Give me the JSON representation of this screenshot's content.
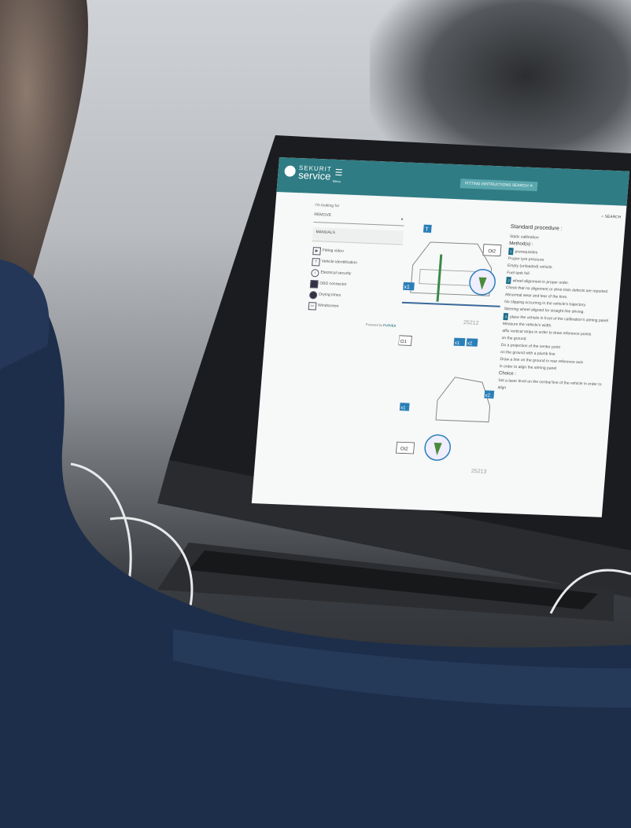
{
  "app": {
    "logo_line1": "SEKURIT",
    "logo_line2": "service",
    "menu_label": "Menu",
    "tab_label": "FITTING INSTRUCTIONS SEARCH"
  },
  "sidebar": {
    "looking_for": "I'm looking for",
    "select_value": "REMOVE",
    "manuals_label": "MANUALS",
    "items": [
      {
        "label": "Fitting video",
        "icon": "play-icon"
      },
      {
        "label": "Vehicle identification",
        "icon": "question-icon"
      },
      {
        "label": "Electrical security",
        "icon": "info-icon"
      },
      {
        "label": "OBD connector",
        "icon": "connector-icon"
      },
      {
        "label": "Drying times",
        "icon": "clock-icon"
      },
      {
        "label": "Windscreen",
        "icon": "windscreen-icon"
      }
    ],
    "powered_by": "Powered by",
    "powered_brand": "FLOVEA"
  },
  "search_label": "SEARCH",
  "diagram": {
    "labels": [
      "T",
      "Ot2",
      "x1",
      "O1",
      "x1",
      "x2",
      "x2",
      "x1",
      "Ot2"
    ],
    "ref_top": "25212",
    "ref_bottom": "25213"
  },
  "procedure": {
    "title": "Standard procedure :",
    "static_calibration": "Static calibration",
    "method_label": "Method(s) :",
    "lines": [
      "prerequisites",
      "Proper tyre pressure.",
      "Empty (unloaded) vehicle.",
      "Fuel tank full.",
      "wheel alignment in proper order.",
      "Check that no alignment or drive train defects are reported.",
      "Abnormal wear and tear of the tires.",
      "No slipping occurring in the vehicle's trajectory.",
      "Steering wheel aligned for straight line driving.",
      "place the vehicle in front of the calibration's aiming panel",
      "Measure the vehicle's width.",
      "affix vertical strips",
      "in order to draw reference points",
      "on the ground.",
      "Do a projection of the center point",
      "on the ground with a plumb line",
      "Draw a line on the ground in rear reference axis",
      "in order to align the aiming panel",
      "Choice :",
      "Set a laser level",
      "on the central line of the vehicle in order to align"
    ]
  }
}
